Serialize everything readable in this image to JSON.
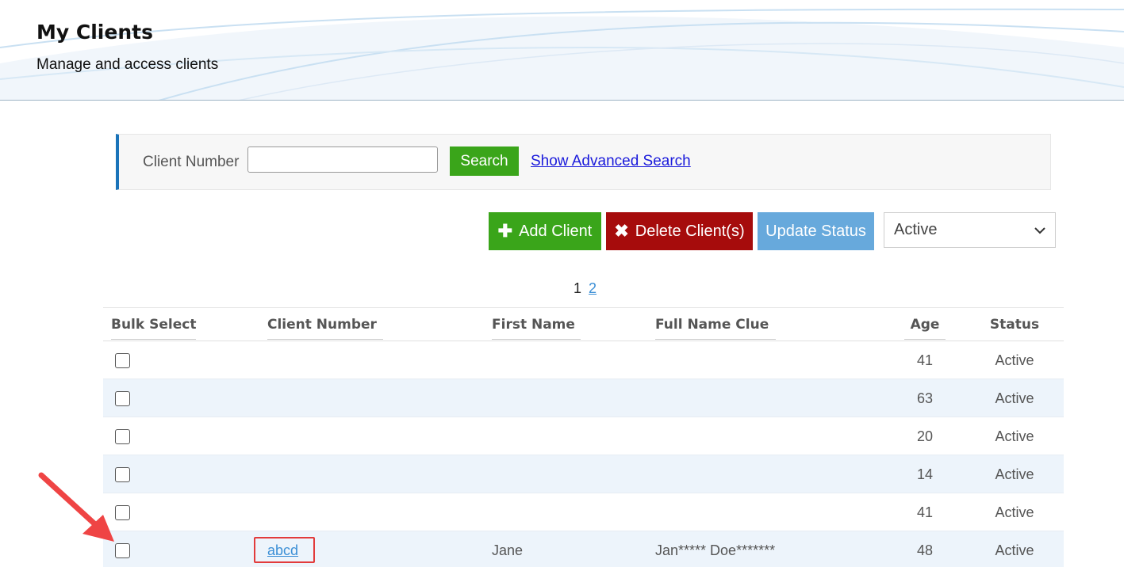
{
  "header": {
    "title": "My Clients",
    "subtitle": "Manage and access clients"
  },
  "search": {
    "label": "Client Number",
    "input_value": "",
    "button_label": "Search",
    "advanced_link": "Show Advanced Search"
  },
  "actions": {
    "add_label": "Add Client",
    "delete_label": "Delete Client(s)",
    "update_label": "Update Status",
    "status_selected": "Active"
  },
  "pagination": {
    "current": "1",
    "next": "2"
  },
  "table": {
    "headers": {
      "bulk_select": "Bulk Select",
      "client_number": "Client Number",
      "first_name": "First Name",
      "full_name_clue": "Full Name Clue",
      "age": "Age",
      "status": "Status"
    },
    "rows": [
      {
        "client_number": "",
        "first_name": "",
        "full_name_clue": "",
        "age": "41",
        "status": "Active"
      },
      {
        "client_number": "",
        "first_name": "",
        "full_name_clue": "",
        "age": "63",
        "status": "Active"
      },
      {
        "client_number": "",
        "first_name": "",
        "full_name_clue": "",
        "age": "20",
        "status": "Active"
      },
      {
        "client_number": "",
        "first_name": "",
        "full_name_clue": "",
        "age": "14",
        "status": "Active"
      },
      {
        "client_number": "",
        "first_name": "",
        "full_name_clue": "",
        "age": "41",
        "status": "Active"
      },
      {
        "client_number": "abcd",
        "first_name": "Jane",
        "full_name_clue": "Jan***** Doe*******",
        "age": "48",
        "status": "Active"
      }
    ]
  },
  "colors": {
    "green": "#3aa51a",
    "red": "#a60c0c",
    "light_blue": "#67a9dc",
    "accent_border": "#1a73b9",
    "annotation_red": "#e23b3b"
  },
  "icons": {
    "add": "plus-icon",
    "delete": "x-icon",
    "select": "chevron-down-icon",
    "annotation": "arrow-icon"
  }
}
